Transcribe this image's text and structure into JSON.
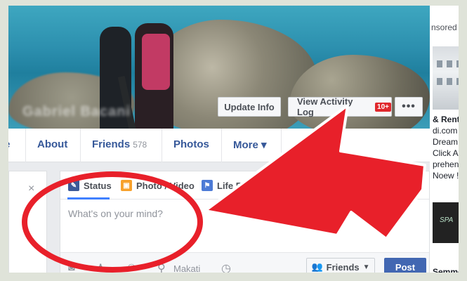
{
  "cover": {
    "blurred_name": "Gabriel Bacani",
    "update_info": "Update Info",
    "view_activity": "View Activity Log",
    "activity_badge": "10+",
    "more_dots": "•••"
  },
  "nav": {
    "tabs": [
      {
        "label": "e"
      },
      {
        "label": "About"
      },
      {
        "label": "Friends",
        "count": "578"
      },
      {
        "label": "Photos"
      },
      {
        "label": "More ▾"
      }
    ]
  },
  "right_ad": {
    "sponsored": "nsored",
    "lines": [
      "& Rent",
      "di.com",
      "Dream",
      "Click A",
      "prehen",
      "Noew !"
    ],
    "spa_text": "SPA",
    "bottom_line": "Semmé"
  },
  "left_panel": {
    "close": "×"
  },
  "composer": {
    "tabs": [
      {
        "label": "Status",
        "icon": "pencil-icon"
      },
      {
        "label": "Photo / Video",
        "icon": "photo-icon"
      },
      {
        "label": "Life Event",
        "icon": "flag-icon"
      }
    ],
    "placeholder": "What's on your mind?",
    "location": "Makati",
    "audience": "Friends",
    "post": "Post"
  },
  "annotation": {
    "circle_color": "#e8202a",
    "arrow_color": "#e8202a"
  }
}
